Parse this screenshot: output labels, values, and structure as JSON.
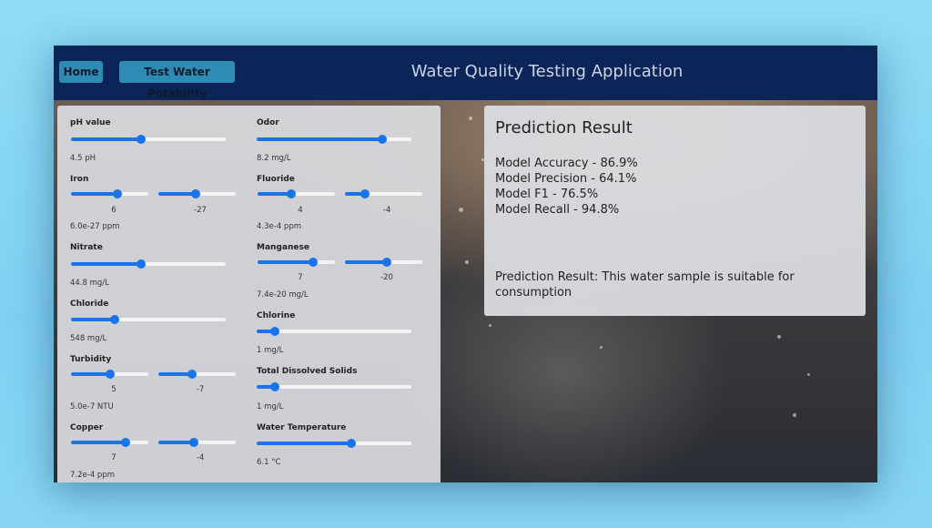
{
  "nav": {
    "home_label": "Home",
    "test_label": "Test Water Potability",
    "title": "Water Quality Testing Application"
  },
  "params": {
    "ph": {
      "label": "pH value",
      "value": "4.5 pH",
      "level": 0.45
    },
    "iron": {
      "label": "Iron",
      "mantissa": "6",
      "exponent": "-27",
      "value": "6.0e-27 ppm",
      "level1": 0.6,
      "level2": 0.48
    },
    "nitrate": {
      "label": "Nitrate",
      "value": "44.8 mg/L",
      "level": 0.45
    },
    "chloride": {
      "label": "Chloride",
      "value": "548 mg/L",
      "level": 0.28
    },
    "turbidity": {
      "label": "Turbidity",
      "mantissa": "5",
      "exponent": "-7",
      "value": "5.0e-7 NTU",
      "level1": 0.5,
      "level2": 0.43
    },
    "copper": {
      "label": "Copper",
      "mantissa": "7",
      "exponent": "-4",
      "value": "7.2e-4 ppm",
      "level1": 0.71,
      "level2": 0.46
    },
    "odor": {
      "label": "Odor",
      "value": "8.2 mg/L",
      "level": 0.81
    },
    "fluoride": {
      "label": "Fluoride",
      "mantissa": "4",
      "exponent": "-4",
      "value": "4.3e-4 ppm",
      "level1": 0.43,
      "level2": 0.26
    },
    "manganese": {
      "label": "Manganese",
      "mantissa": "7",
      "exponent": "-20",
      "value": "7.4e-20 mg/L",
      "level1": 0.72,
      "level2": 0.54
    },
    "chlorine": {
      "label": "Chlorine",
      "value": "1 mg/L",
      "level": 0.12
    },
    "tds": {
      "label": "Total Dissolved Solids",
      "value": "1 mg/L",
      "level": 0.12
    },
    "temperature": {
      "label": "Water Temperature",
      "value": "6.1 °C",
      "level": 0.61
    }
  },
  "result": {
    "title": "Prediction Result",
    "accuracy": "Model Accuracy - 86.9%",
    "precision": "Model Precision - 64.1%",
    "f1": "Model F1 - 76.5%",
    "recall": "Model Recall - 94.8%",
    "prediction": "Prediction Result: This water sample is suitable for consumption"
  },
  "colors": {
    "navbar": "#0b2559",
    "button": "#2e8bb3",
    "slider": "#1a73e8"
  }
}
